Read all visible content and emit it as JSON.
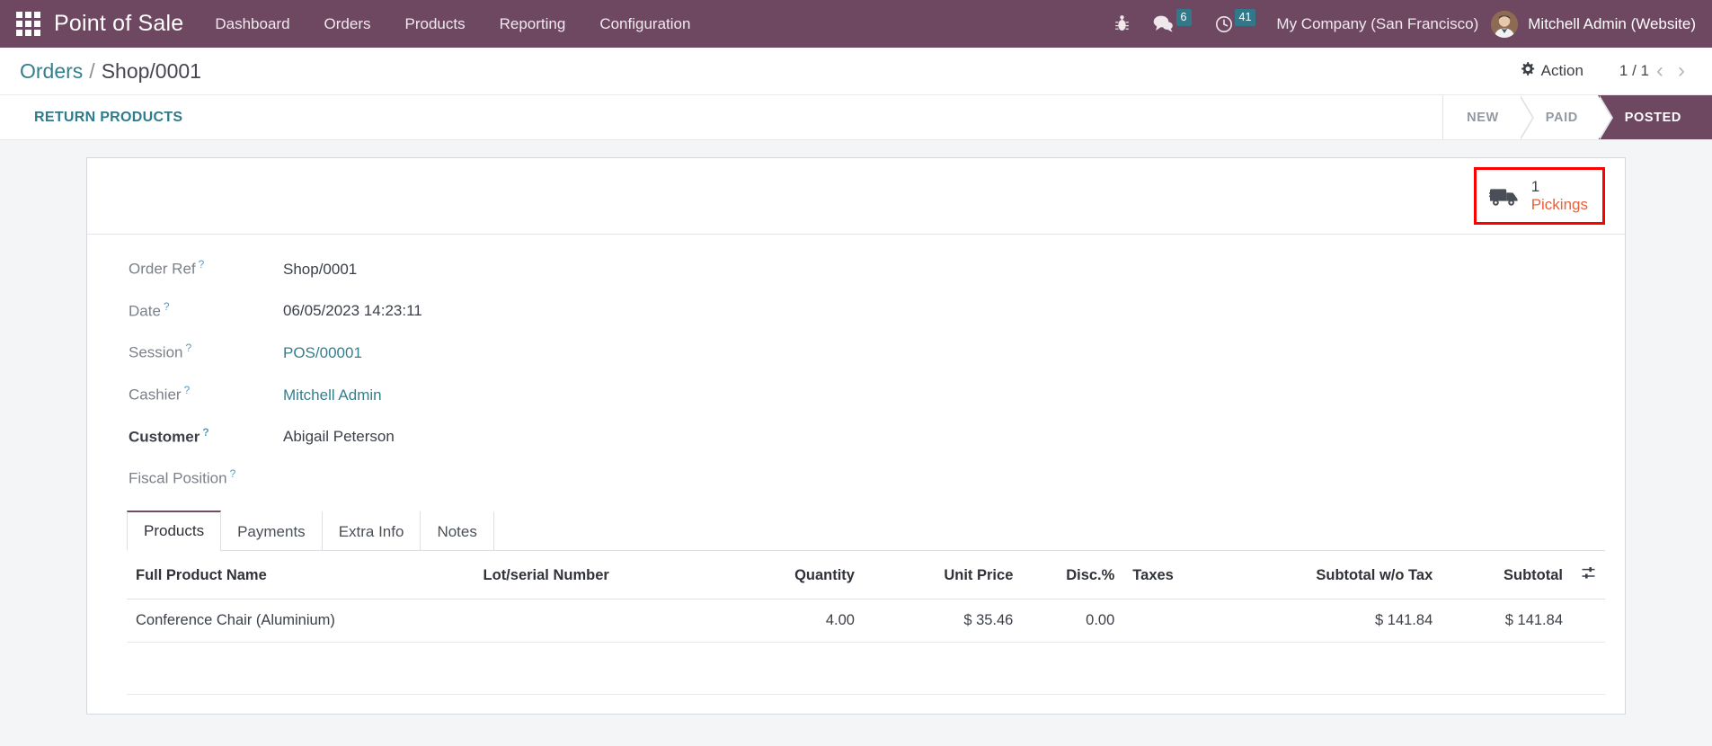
{
  "navbar": {
    "apps_icon": "apps-grid-icon",
    "brand": "Point of Sale",
    "menu": [
      {
        "label": "Dashboard"
      },
      {
        "label": "Orders"
      },
      {
        "label": "Products"
      },
      {
        "label": "Reporting"
      },
      {
        "label": "Configuration"
      }
    ],
    "systray": {
      "debug_icon": "bug-icon",
      "messages_icon": "chat-bubble-icon",
      "messages_count": "6",
      "activities_icon": "clock-icon",
      "activities_count": "41",
      "company": "My Company (San Francisco)",
      "avatar_icon": "user-avatar",
      "user": "Mitchell Admin (Website)"
    },
    "colors": {
      "background": "#6e4861",
      "badge": "#31788b",
      "text": "#ffffff"
    }
  },
  "control_panel": {
    "breadcrumb": {
      "parent": "Orders",
      "separator": "/",
      "current": "Shop/0001"
    },
    "action_icon": "gear-icon",
    "action_label": "Action",
    "pager": {
      "value": "1 / 1",
      "prev_icon": "chevron-left-icon",
      "next_icon": "chevron-right-icon"
    },
    "return_products_button": "RETURN PRODUCTS",
    "statusbar": [
      {
        "label": "NEW",
        "active": false
      },
      {
        "label": "PAID",
        "active": false
      },
      {
        "label": "POSTED",
        "active": true
      }
    ],
    "colors": {
      "link": "#337f8e",
      "active_status_bg": "#6e4861"
    }
  },
  "sheet": {
    "stat_button": {
      "icon": "truck-icon",
      "value": "1",
      "label": "Pickings",
      "highlight_color": "#ff0000",
      "label_color": "#e8603c"
    },
    "fields": [
      {
        "label": "Order Ref",
        "tip": "?",
        "value": "Shop/0001",
        "required": false,
        "link": false
      },
      {
        "label": "Date",
        "tip": "?",
        "value": "06/05/2023 14:23:11",
        "required": false,
        "link": false
      },
      {
        "label": "Session",
        "tip": "?",
        "value": "POS/00001",
        "required": false,
        "link": true
      },
      {
        "label": "Cashier",
        "tip": "?",
        "value": "Mitchell Admin",
        "required": false,
        "link": true
      },
      {
        "label": "Customer",
        "tip": "?",
        "value": "Abigail Peterson",
        "required": true,
        "link": false
      },
      {
        "label": "Fiscal Position",
        "tip": "?",
        "value": "",
        "required": false,
        "link": false
      }
    ],
    "tabs": [
      {
        "label": "Products",
        "active": true
      },
      {
        "label": "Payments",
        "active": false
      },
      {
        "label": "Extra Info",
        "active": false
      },
      {
        "label": "Notes",
        "active": false
      }
    ],
    "table": {
      "columns": [
        {
          "label": "Full Product Name",
          "align": "left"
        },
        {
          "label": "Lot/serial Number",
          "align": "left"
        },
        {
          "label": "Quantity",
          "align": "right"
        },
        {
          "label": "Unit Price",
          "align": "right"
        },
        {
          "label": "Disc.%",
          "align": "right"
        },
        {
          "label": "Taxes",
          "align": "left"
        },
        {
          "label": "Subtotal w/o Tax",
          "align": "right"
        },
        {
          "label": "Subtotal",
          "align": "right"
        }
      ],
      "optional_columns_icon": "column-settings-icon",
      "rows": [
        {
          "full_product_name": "Conference Chair (Aluminium)",
          "lot_serial_number": "",
          "quantity": "4.00",
          "unit_price": "$ 35.46",
          "discount": "0.00",
          "taxes": "",
          "subtotal_wo_tax": "$ 141.84",
          "subtotal": "$ 141.84"
        }
      ]
    }
  }
}
